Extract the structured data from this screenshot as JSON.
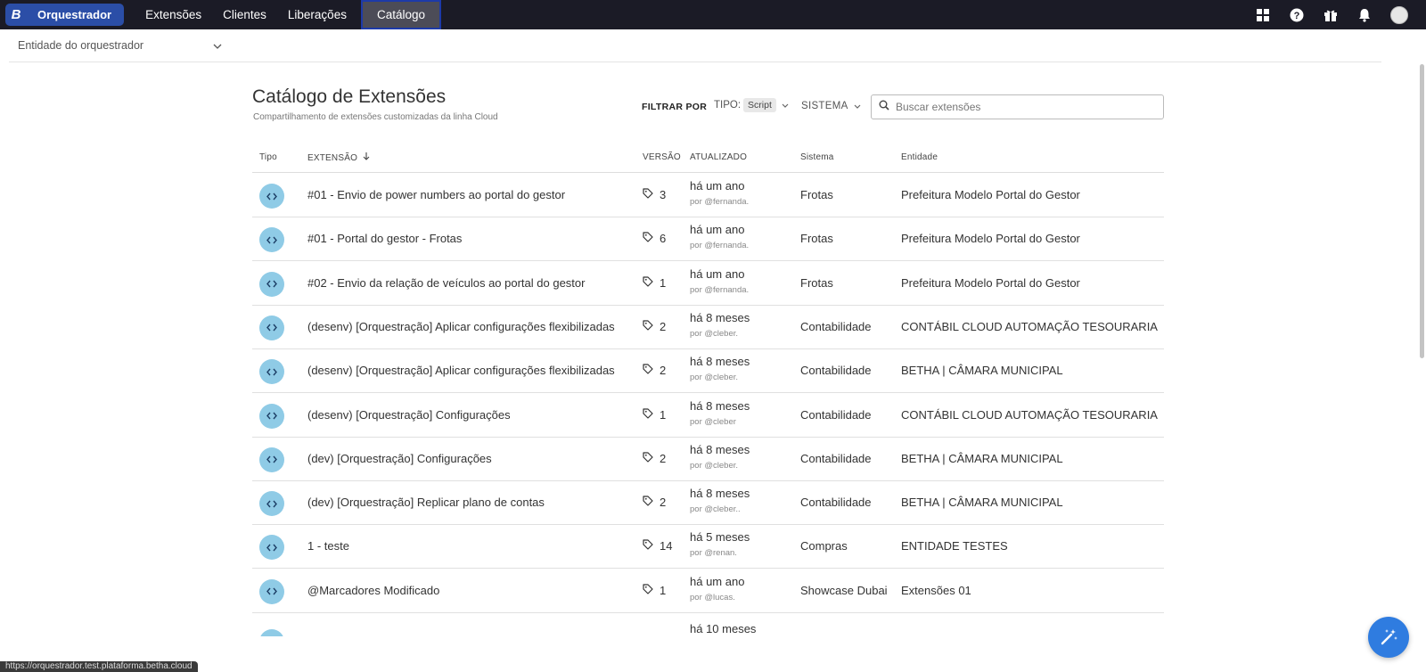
{
  "nav": {
    "brand_letter": "B",
    "app_name": "Orquestrador",
    "items": [
      {
        "label": "Extensões"
      },
      {
        "label": "Clientes"
      },
      {
        "label": "Liberações"
      },
      {
        "label": "Catálogo"
      }
    ],
    "active": "Catálogo"
  },
  "entity_selector": {
    "value": "Entidade do orquestrador"
  },
  "header": {
    "title": "Catálogo de Extensões",
    "subtitle": "Compartilhamento de extensões customizadas da linha Cloud"
  },
  "filters": {
    "label": "FILTRAR POR",
    "tipo_label": "TIPO:",
    "tipo_value": "Script",
    "sistema_label": "SISTEMA",
    "search_placeholder": "Buscar extensões"
  },
  "table": {
    "columns": {
      "tipo": "Tipo",
      "extensao": "EXTENSÃO",
      "versao": "VERSÃO",
      "atualizado": "ATUALIZADO",
      "sistema": "Sistema",
      "entidade": "Entidade"
    },
    "rows": [
      {
        "name": "#01 - Envio de power numbers ao portal do gestor",
        "version": "3",
        "updated": "há um ano",
        "by": "por @fernanda.",
        "system": "Frotas",
        "entity": "Prefeitura Modelo Portal do Gestor"
      },
      {
        "name": "#01 - Portal do gestor - Frotas",
        "version": "6",
        "updated": "há um ano",
        "by": "por @fernanda.",
        "system": "Frotas",
        "entity": "Prefeitura Modelo Portal do Gestor"
      },
      {
        "name": "#02 - Envio da relação de veículos ao portal do gestor",
        "version": "1",
        "updated": "há um ano",
        "by": "por @fernanda.",
        "system": "Frotas",
        "entity": "Prefeitura Modelo Portal do Gestor"
      },
      {
        "name": "(desenv) [Orquestração] Aplicar configurações flexibilizadas",
        "version": "2",
        "updated": "há 8 meses",
        "by": "por @cleber.",
        "system": "Contabilidade",
        "entity": "CONTÁBIL CLOUD AUTOMAÇÃO TESOURARIA"
      },
      {
        "name": "(desenv) [Orquestração] Aplicar configurações flexibilizadas",
        "version": "2",
        "updated": "há 8 meses",
        "by": "por @cleber.",
        "system": "Contabilidade",
        "entity": "BETHA | CÂMARA MUNICIPAL"
      },
      {
        "name": "(desenv) [Orquestração] Configurações",
        "version": "1",
        "updated": "há 8 meses",
        "by": "por @cleber",
        "system": "Contabilidade",
        "entity": "CONTÁBIL CLOUD AUTOMAÇÃO TESOURARIA"
      },
      {
        "name": "(dev) [Orquestração] Configurações",
        "version": "2",
        "updated": "há 8 meses",
        "by": "por @cleber.",
        "system": "Contabilidade",
        "entity": "BETHA | CÂMARA MUNICIPAL"
      },
      {
        "name": "(dev) [Orquestração] Replicar plano de contas",
        "version": "2",
        "updated": "há 8 meses",
        "by": "por @cleber..",
        "system": "Contabilidade",
        "entity": "BETHA | CÂMARA MUNICIPAL"
      },
      {
        "name": "1 - teste",
        "version": "14",
        "updated": "há 5 meses",
        "by": "por @renan.",
        "system": "Compras",
        "entity": "ENTIDADE TESTES"
      },
      {
        "name": "@Marcadores Modificado",
        "version": "1",
        "updated": "há um ano",
        "by": "por @lucas.",
        "system": "Showcase Dubai",
        "entity": "Extensões 01"
      }
    ],
    "partial_row": {
      "updated": "há 10 meses"
    }
  },
  "status_bar": {
    "url": "https://orquestrador.test.plataforma.betha.cloud"
  },
  "colors": {
    "topbar": "#1b1b26",
    "brand": "#2b4ea7",
    "type_icon": "#8fcbe6",
    "fab": "#2f7ce0"
  }
}
